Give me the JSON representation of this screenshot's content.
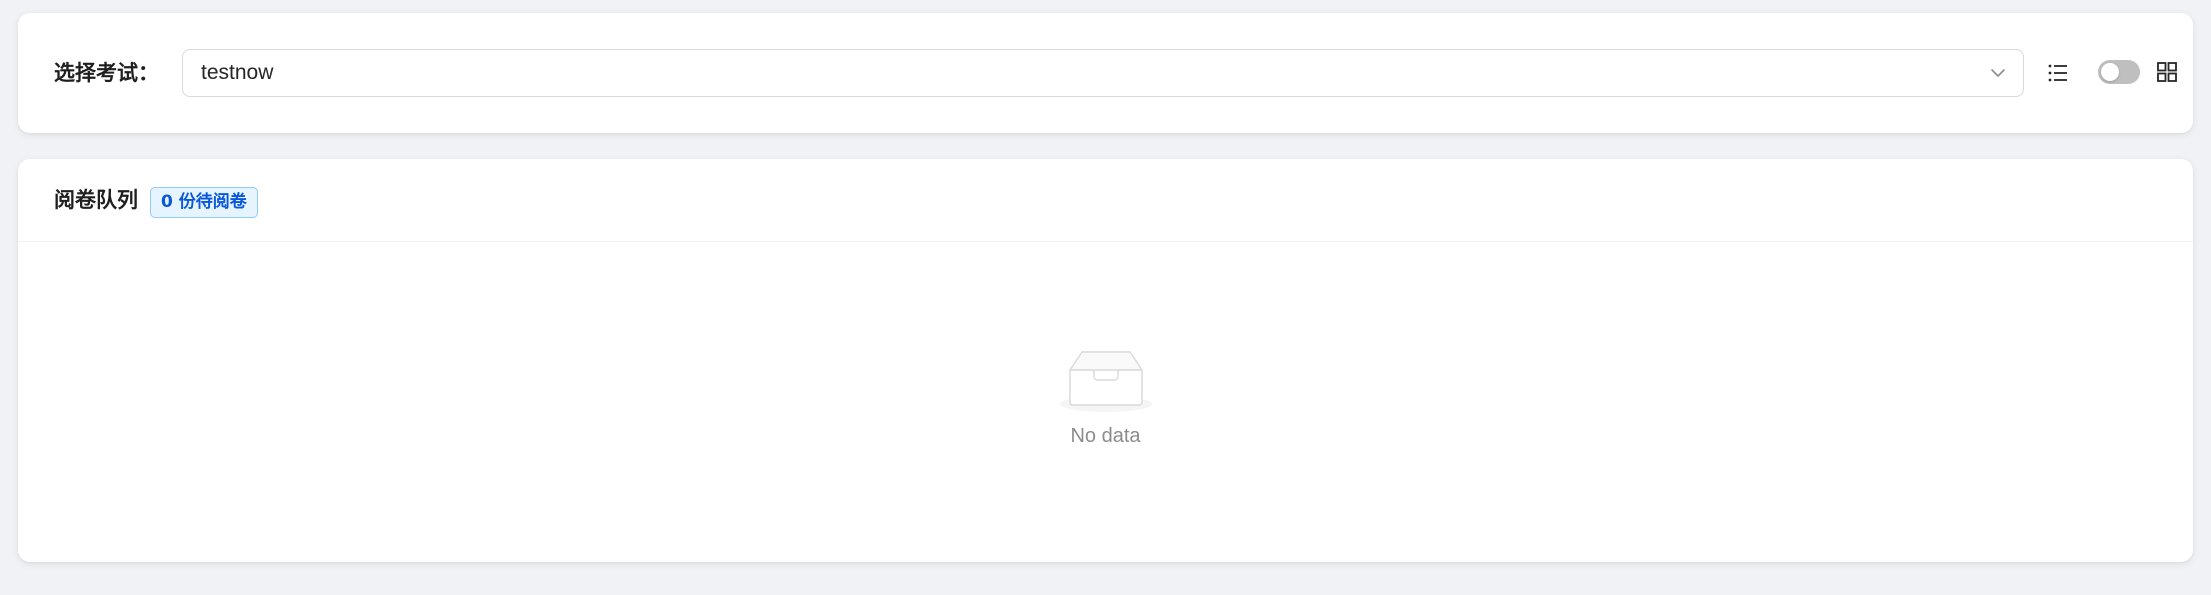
{
  "filter": {
    "label": "选择考试：",
    "selected_exam": "testnow",
    "chevron_icon": "chevron-down-icon",
    "view_toggle": {
      "left_icon": "list-icon",
      "right_icon": "grid-icon",
      "state": "off"
    }
  },
  "queue": {
    "title": "阅卷队列",
    "badge": "0 份待阅卷",
    "empty_icon": "empty-inbox-icon",
    "empty_text": "No data"
  },
  "colors": {
    "background": "#f0f2f5",
    "badge_text": "#0958d9",
    "badge_bg": "#e6f4ff",
    "badge_border": "#91caff",
    "toggle_off": "#bfbfbf"
  }
}
